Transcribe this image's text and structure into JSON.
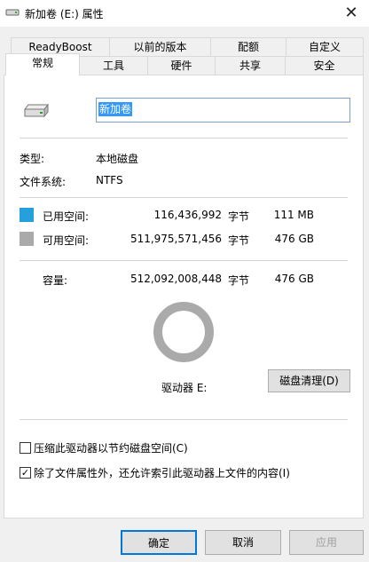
{
  "window": {
    "title": "新加卷 (E:) 属性",
    "close_glyph": "✕"
  },
  "tabs_row1": [
    "ReadyBoost",
    "以前的版本",
    "配额",
    "自定义"
  ],
  "tabs_row2": [
    "常规",
    "工具",
    "硬件",
    "共享",
    "安全"
  ],
  "active_tab": "常规",
  "general": {
    "volume_name": "新加卷",
    "type_label": "类型:",
    "type_value": "本地磁盘",
    "fs_label": "文件系统:",
    "fs_value": "NTFS",
    "used": {
      "label": "已用空间:",
      "bytes": "116,436,992",
      "unit": "字节",
      "size": "111 MB",
      "color": "#26a0da"
    },
    "free": {
      "label": "可用空间:",
      "bytes": "511,975,571,456",
      "unit": "字节",
      "size": "476 GB",
      "color": "#aaaaaa"
    },
    "capacity": {
      "label": "容量:",
      "bytes": "512,092,008,448",
      "unit": "字节",
      "size": "476 GB"
    },
    "drive_label": "驱动器 E:",
    "cleanup_button": "磁盘清理(D)",
    "compress_checkbox": {
      "label": "压缩此驱动器以节约磁盘空间(C)",
      "checked": false
    },
    "index_checkbox": {
      "label": "除了文件属性外，还允许索引此驱动器上文件的内容(I)",
      "checked": true,
      "check_glyph": "✓"
    }
  },
  "footer": {
    "ok": "确定",
    "cancel": "取消",
    "apply": "应用"
  }
}
